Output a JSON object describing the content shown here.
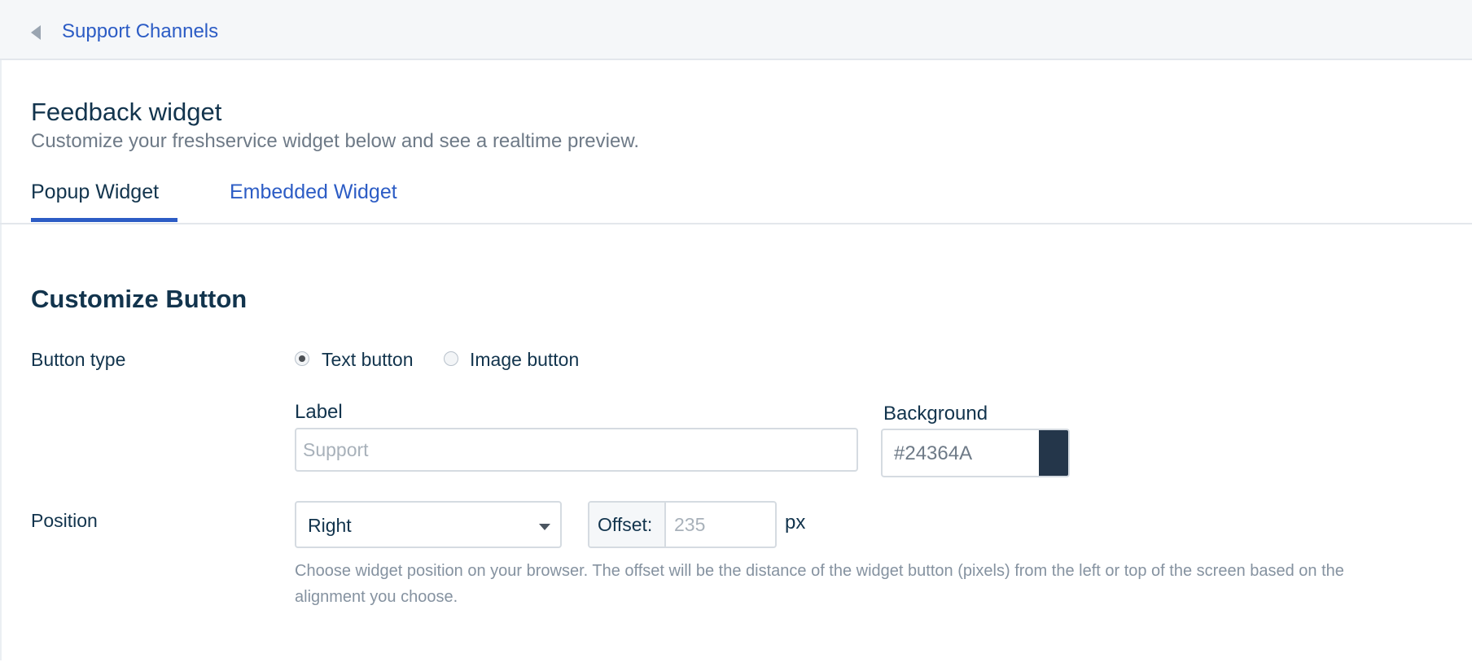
{
  "breadcrumb": {
    "back_icon": "caret-left-icon",
    "label": "Support Channels"
  },
  "page": {
    "title": "Feedback widget",
    "subtitle": "Customize your freshservice widget below and see a realtime preview."
  },
  "tabs": [
    {
      "label": "Popup Widget",
      "active": true
    },
    {
      "label": "Embedded Widget",
      "active": false
    }
  ],
  "section": {
    "title": "Customize Button",
    "button_type": {
      "label": "Button type",
      "options": [
        {
          "label": "Text button",
          "selected": true
        },
        {
          "label": "Image button",
          "selected": false
        }
      ]
    },
    "label_field": {
      "label": "Label",
      "placeholder": "Support",
      "value": ""
    },
    "background_field": {
      "label": "Background",
      "value": "#24364A",
      "swatch_color": "#24364A"
    },
    "position": {
      "label": "Position",
      "selected": "Right",
      "offset_label": "Offset:",
      "offset_placeholder": "235",
      "unit": "px",
      "help": "Choose widget position on your browser. The offset will be the distance of the widget button (pixels) from the left or top of the screen based on the alignment you choose."
    }
  },
  "colors": {
    "accent": "#2C5CC5",
    "text": "#12344D",
    "muted": "#6E7A87"
  }
}
